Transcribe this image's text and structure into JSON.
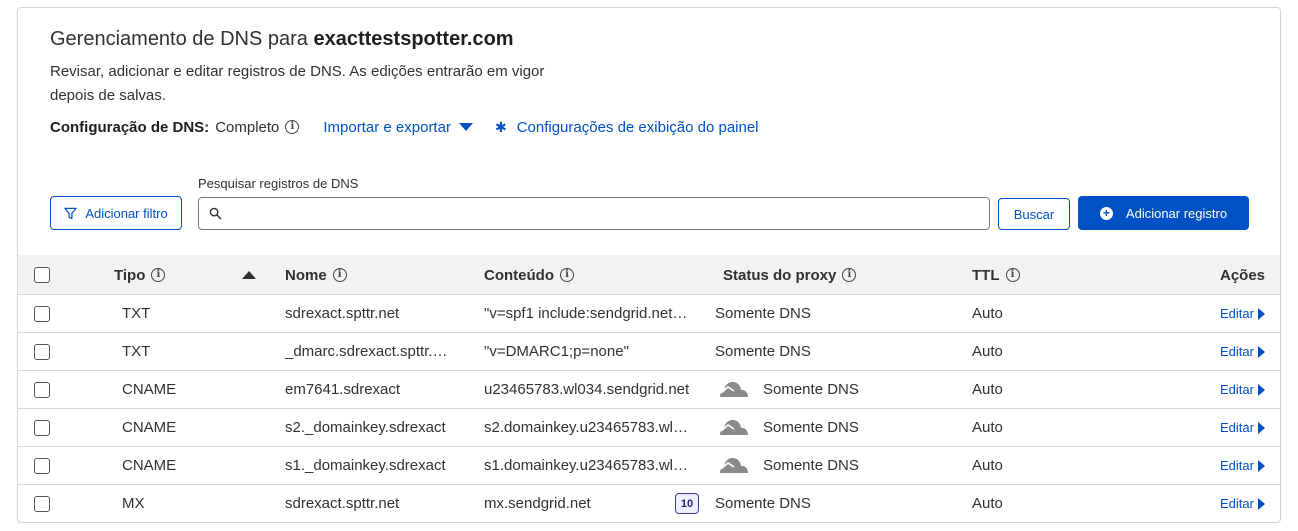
{
  "header": {
    "title_prefix": "Gerenciamento de DNS para",
    "domain": "exacttestspotter.com",
    "description": "Revisar, adicionar e editar registros de DNS. As edições entrarão em vigor depois de salvas."
  },
  "config": {
    "label": "Configuração de DNS:",
    "value": "Completo",
    "import_export": "Importar e exportar",
    "display_settings": "Configurações de exibição do painel"
  },
  "toolbar": {
    "add_filter": "Adicionar filtro",
    "search_label": "Pesquisar registros de DNS",
    "search_value": "",
    "search_button": "Buscar",
    "add_record": "Adicionar registro"
  },
  "table": {
    "headers": {
      "type": "Tipo",
      "name": "Nome",
      "content": "Conteúdo",
      "proxy": "Status do proxy",
      "ttl": "TTL",
      "actions": "Ações"
    },
    "rows": [
      {
        "type": "TXT",
        "name": "sdrexact.spttr.net",
        "content": "\"v=spf1 include:sendgrid.net…",
        "proxy": "Somente DNS",
        "ttl": "Auto",
        "edit": "Editar"
      },
      {
        "type": "TXT",
        "name": "_dmarc.sdrexact.spttr.…",
        "content": "\"v=DMARC1;p=none\"",
        "proxy": "Somente DNS",
        "ttl": "Auto",
        "edit": "Editar"
      },
      {
        "type": "CNAME",
        "name": "em7641.sdrexact",
        "content": "u23465783.wl034.sendgrid.net",
        "proxy": "Somente DNS",
        "ttl": "Auto",
        "edit": "Editar"
      },
      {
        "type": "CNAME",
        "name": "s2._domainkey.sdrexact",
        "content": "s2.domainkey.u23465783.wl…",
        "proxy": "Somente DNS",
        "ttl": "Auto",
        "edit": "Editar"
      },
      {
        "type": "CNAME",
        "name": "s1._domainkey.sdrexact",
        "content": "s1.domainkey.u23465783.wl…",
        "proxy": "Somente DNS",
        "ttl": "Auto",
        "edit": "Editar"
      },
      {
        "type": "MX",
        "name": "sdrexact.spttr.net",
        "content": "mx.sendgrid.net",
        "priority": "10",
        "proxy": "Somente DNS",
        "ttl": "Auto",
        "edit": "Editar"
      }
    ]
  },
  "colors": {
    "accent": "#0051c3",
    "header_bg": "#f2f2f2",
    "border": "#d9d9d9",
    "cloud_grey": "#8a8a8a"
  },
  "icons": [
    "info-icon",
    "caret-down-icon",
    "gear-icon",
    "filter-icon",
    "search-icon",
    "plus-circle-icon",
    "sort-up-icon",
    "cloud-icon",
    "chevron-right-icon"
  ]
}
